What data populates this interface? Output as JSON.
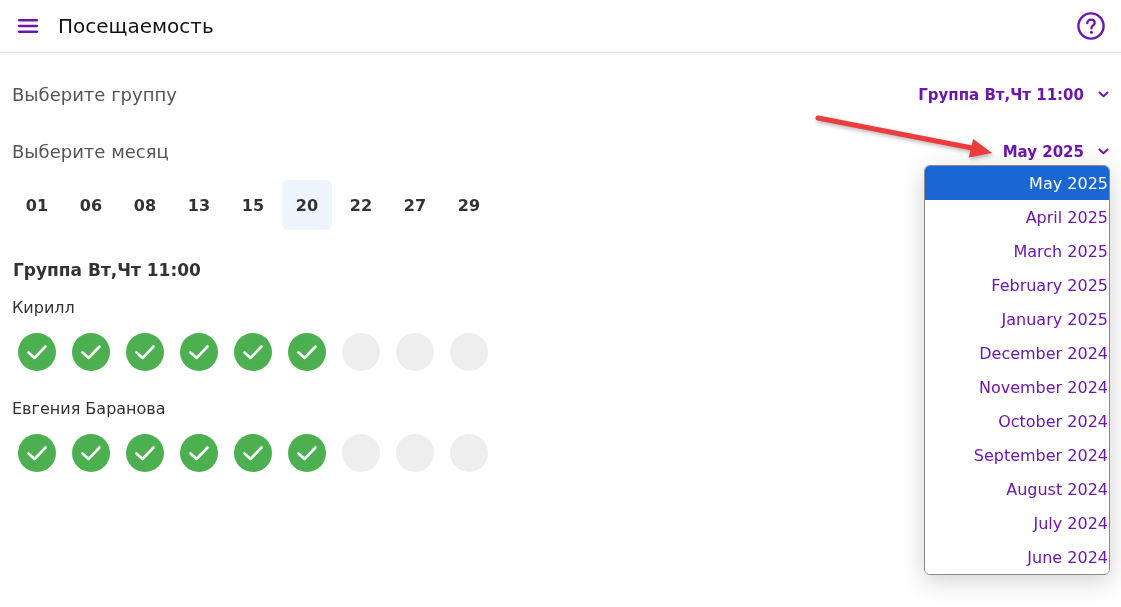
{
  "header": {
    "title": "Посещаемость"
  },
  "filters": [
    {
      "label": "Выберите группу",
      "value": "Группа Вт,Чт 11:00"
    },
    {
      "label": "Выберите месяц",
      "value": "May 2025",
      "options": [
        {
          "label": "May 2025",
          "selected": true
        },
        {
          "label": "April 2025",
          "selected": false
        },
        {
          "label": "March 2025",
          "selected": false
        },
        {
          "label": "February 2025",
          "selected": false
        },
        {
          "label": "January 2025",
          "selected": false
        },
        {
          "label": "December 2024",
          "selected": false
        },
        {
          "label": "November 2024",
          "selected": false
        },
        {
          "label": "October 2024",
          "selected": false
        },
        {
          "label": "September 2024",
          "selected": false
        },
        {
          "label": "August 2024",
          "selected": false
        },
        {
          "label": "July 2024",
          "selected": false
        },
        {
          "label": "June 2024",
          "selected": false
        }
      ]
    }
  ],
  "dates": [
    {
      "label": "01",
      "selected": false
    },
    {
      "label": "06",
      "selected": false
    },
    {
      "label": "08",
      "selected": false
    },
    {
      "label": "13",
      "selected": false
    },
    {
      "label": "15",
      "selected": false
    },
    {
      "label": "20",
      "selected": true
    },
    {
      "label": "22",
      "selected": false
    },
    {
      "label": "27",
      "selected": false
    },
    {
      "label": "29",
      "selected": false
    }
  ],
  "group": {
    "title": "Группа Вт,Чт 11:00",
    "students": [
      {
        "name": "Кирилл",
        "attendance": [
          {
            "present": true
          },
          {
            "present": true
          },
          {
            "present": true
          },
          {
            "present": true
          },
          {
            "present": true
          },
          {
            "present": true
          },
          {
            "present": false
          },
          {
            "present": false
          },
          {
            "present": false
          }
        ]
      },
      {
        "name": "Евгения Баранова",
        "attendance": [
          {
            "present": true
          },
          {
            "present": true
          },
          {
            "present": true
          },
          {
            "present": true
          },
          {
            "present": true
          },
          {
            "present": true
          },
          {
            "present": false
          },
          {
            "present": false
          },
          {
            "present": false
          }
        ]
      }
    ]
  }
}
